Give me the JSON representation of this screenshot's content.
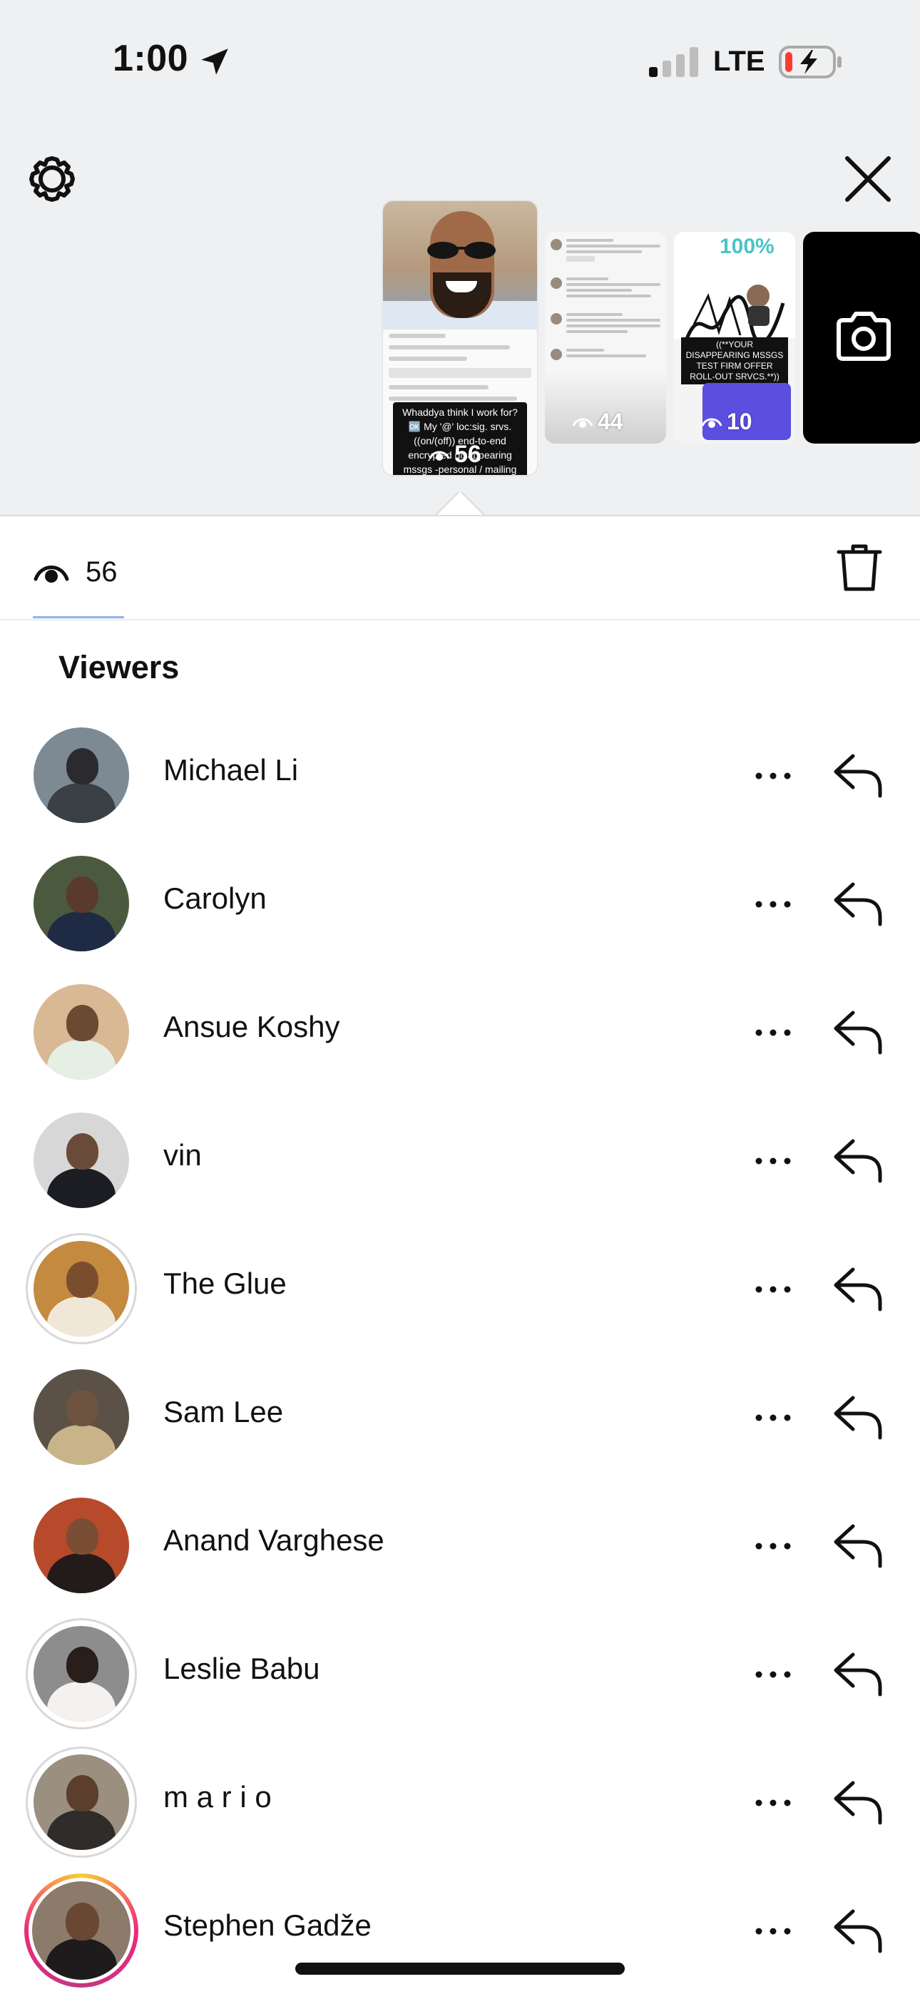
{
  "status_bar": {
    "time": "1:00",
    "network": "LTE",
    "signal_bars_active": 1,
    "battery_level": 0.1,
    "battery_charging": true
  },
  "story_tray": {
    "thumbnails": [
      {
        "caption": "Whaddya think I work for? 🆗 My '@' loc:sig. srvs. ((on/(off)) end-to-end encrypted disappearing mssgs -personal / mailing methodology",
        "views": "56",
        "selected": true
      },
      {
        "views": "44",
        "selected": false
      },
      {
        "percent": "100%",
        "banner": "((**YOUR DISAPPEARING MSSGS TEST FIRM OFFER ROLL-OUT SRVCS.**))",
        "views": "10",
        "selected": false
      }
    ],
    "camera_icon": "camera-icon"
  },
  "tabs": {
    "views_count": "56"
  },
  "viewers": {
    "title": "Viewers",
    "items": [
      {
        "name": "Michael Li",
        "ring": "none",
        "head": "#2b2b2e",
        "body": "#3b3f46",
        "bg": "#7d8a94"
      },
      {
        "name": "Carolyn",
        "ring": "none",
        "head": "#5a3a2a",
        "body": "#1f2a44",
        "bg": "#4b5a3e"
      },
      {
        "name": "Ansue Koshy",
        "ring": "none",
        "head": "#6b4a34",
        "body": "#e6efe4",
        "bg": "#d9b894"
      },
      {
        "name": "vin",
        "ring": "none",
        "head": "#6a4b3a",
        "body": "#1b1d22",
        "bg": "#d7d7d7"
      },
      {
        "name": "The Glue",
        "ring": "grey",
        "head": "#7a4e2d",
        "body": "#f1e7d6",
        "bg": "#c48a3f"
      },
      {
        "name": "Sam Lee",
        "ring": "none",
        "head": "#6e5440",
        "body": "#c9b48a",
        "bg": "#5b5146"
      },
      {
        "name": "Anand Varghese",
        "ring": "none",
        "head": "#7a4d35",
        "body": "#231b1a",
        "bg": "#b64a2a"
      },
      {
        "name": "Leslie Babu",
        "ring": "grey",
        "head": "#2a1e1a",
        "body": "#f4f1ee",
        "bg": "#8d8d8d"
      },
      {
        "name": "m a r i o",
        "ring": "grey",
        "head": "#5b3e2c",
        "body": "#2f2c2a",
        "bg": "#9b8f80"
      },
      {
        "name": "Stephen Gadže",
        "ring": "story",
        "head": "#6a4733",
        "body": "#1d1b1c",
        "bg": "#8c7a6a"
      }
    ]
  },
  "colors": {
    "top_background": "#eff0f2",
    "accent_underline": "#8fb2f0",
    "text": "#111111"
  },
  "icons": [
    "gear-icon",
    "close-icon",
    "eye-icon",
    "trash-icon",
    "more-icon",
    "reply-icon",
    "camera-icon",
    "location-arrow-icon",
    "signal-icon",
    "battery-icon"
  ]
}
